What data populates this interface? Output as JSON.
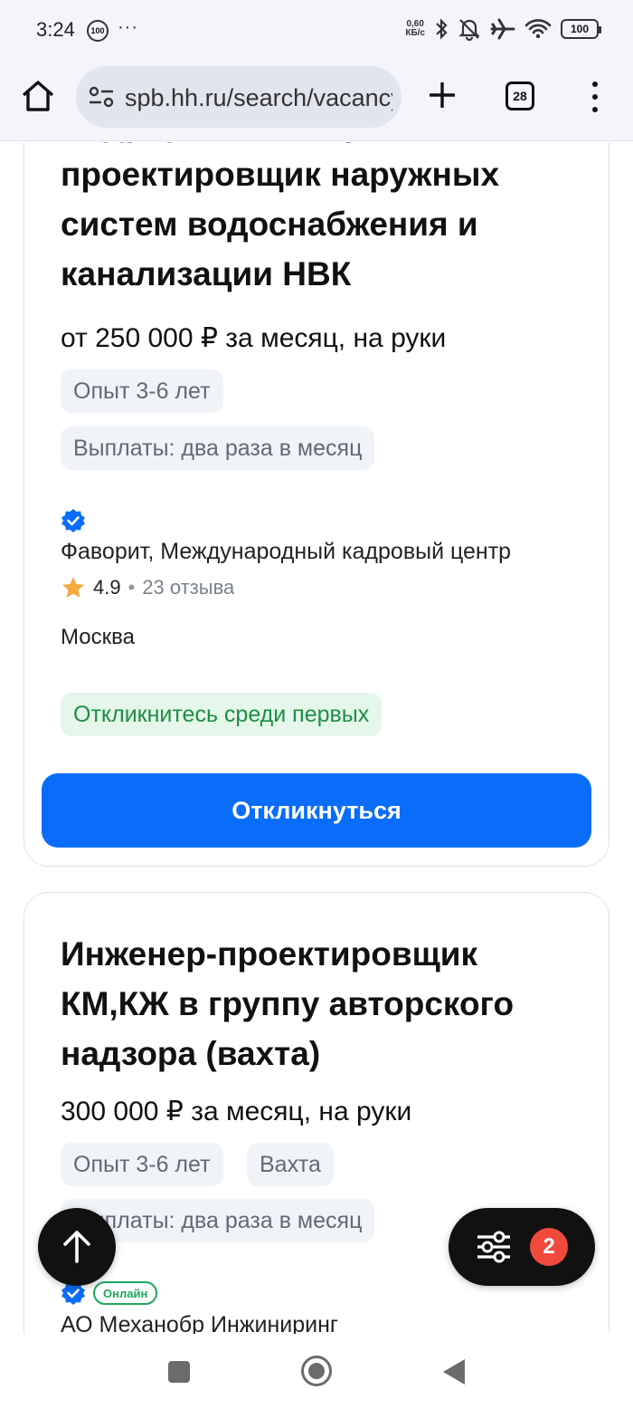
{
  "status_bar": {
    "time": "3:24",
    "notif_badge": "100",
    "more_dots": "···",
    "net_speed_value": "0,60",
    "net_speed_unit": "КБ/с",
    "battery": "100"
  },
  "browser": {
    "url": "spb.hh.ru/search/vacancy",
    "tab_count": "28"
  },
  "vacancies": [
    {
      "title": "Ведущий инженер проектировщик наружных систем водоснабжения и канализации НВК",
      "salary": "от 250 000 ₽ за месяц, на руки",
      "tags": [
        "Опыт 3-6 лет",
        "Выплаты: два раза в месяц"
      ],
      "company": "Фаворит, Международный кадровый центр",
      "rating": "4.9",
      "rating_separator": "•",
      "reviews": "23 отзыва",
      "city": "Москва",
      "highlight": "Откликнитесь среди первых",
      "apply_label": "Откликнуться"
    },
    {
      "title": "Инженер-проектировщик КМ,КЖ в группу авторского надзора (вахта)",
      "salary": "300 000 ₽ за месяц, на руки",
      "tags": [
        "Опыт 3-6 лет",
        "Вахта",
        "Выплаты: два раза в месяц"
      ],
      "online_label": "Онлайн",
      "company": "АО Механобр Инжиниринг"
    }
  ],
  "filter_fab": {
    "count": "2"
  },
  "colors": {
    "accent": "#0a6dfa",
    "badge_red": "#f04a3d",
    "success_green": "#1d8e43",
    "tag_bg": "#f0f3f7"
  }
}
